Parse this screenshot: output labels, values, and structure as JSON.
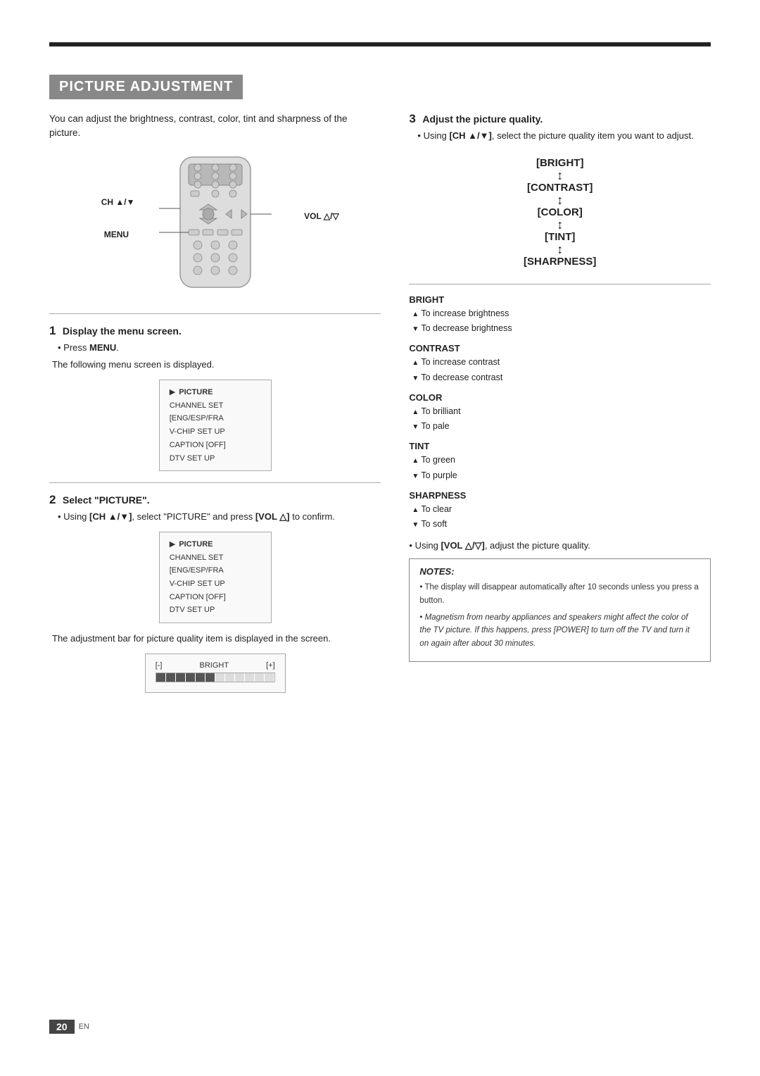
{
  "page": {
    "top_rule": true,
    "page_number": "20",
    "page_lang": "EN"
  },
  "section": {
    "title": "PICTURE ADJUSTMENT"
  },
  "intro": {
    "text": "You can adjust the brightness, contrast, color, tint and sharpness of the picture."
  },
  "remote": {
    "ch_label": "CH ▲/▼",
    "menu_label": "MENU",
    "vol_label": "VOL △/▽"
  },
  "steps": {
    "step1": {
      "number": "1",
      "title": "Display the menu screen.",
      "bullet1": "Press [MENU].",
      "bullet2": "The following menu screen is displayed."
    },
    "step2": {
      "number": "2",
      "title": "Select \"PICTURE\".",
      "bullet1": "Using [CH ▲/▼], select \"PICTURE\" and press [VOL △] to confirm.",
      "note": "The adjustment bar for picture quality item is displayed in the screen."
    },
    "step3": {
      "number": "3",
      "title": "Adjust the picture quality.",
      "bullet1": "Using [CH ▲/▼], select the picture quality item you want to adjust."
    }
  },
  "menu_screen": {
    "items": [
      "▶ PICTURE",
      "CHANNEL SET",
      "[ENG/ESP/FRA",
      "V-CHIP SET UP",
      "CAPTION [OFF]",
      "DTV SET UP"
    ]
  },
  "quality_items": [
    "[BRIGHT]",
    "[CONTRAST]",
    "[COLOR]",
    "[TINT]",
    "[SHARPNESS]"
  ],
  "attributes": {
    "bright": {
      "title": "BRIGHT",
      "up": "To increase brightness",
      "down": "To decrease brightness"
    },
    "contrast": {
      "title": "CONTRAST",
      "up": "To increase contrast",
      "down": "To decrease contrast"
    },
    "color": {
      "title": "COLOR",
      "up": "To brilliant",
      "down": "To pale"
    },
    "tint": {
      "title": "TINT",
      "up": "To green",
      "down": "To purple"
    },
    "sharpness": {
      "title": "SHARPNESS",
      "up": "To clear",
      "down": "To soft"
    }
  },
  "vol_line": "Using [VOL △/▽], adjust the picture quality.",
  "notes": {
    "title": "NOTES:",
    "note1": "The display will disappear automatically after 10 seconds unless you press a button.",
    "note2": "Magnetism from nearby appliances and speakers might affect the color of the TV picture. If this happens, press [POWER] to turn off the TV and turn it on again after about 30 minutes."
  }
}
